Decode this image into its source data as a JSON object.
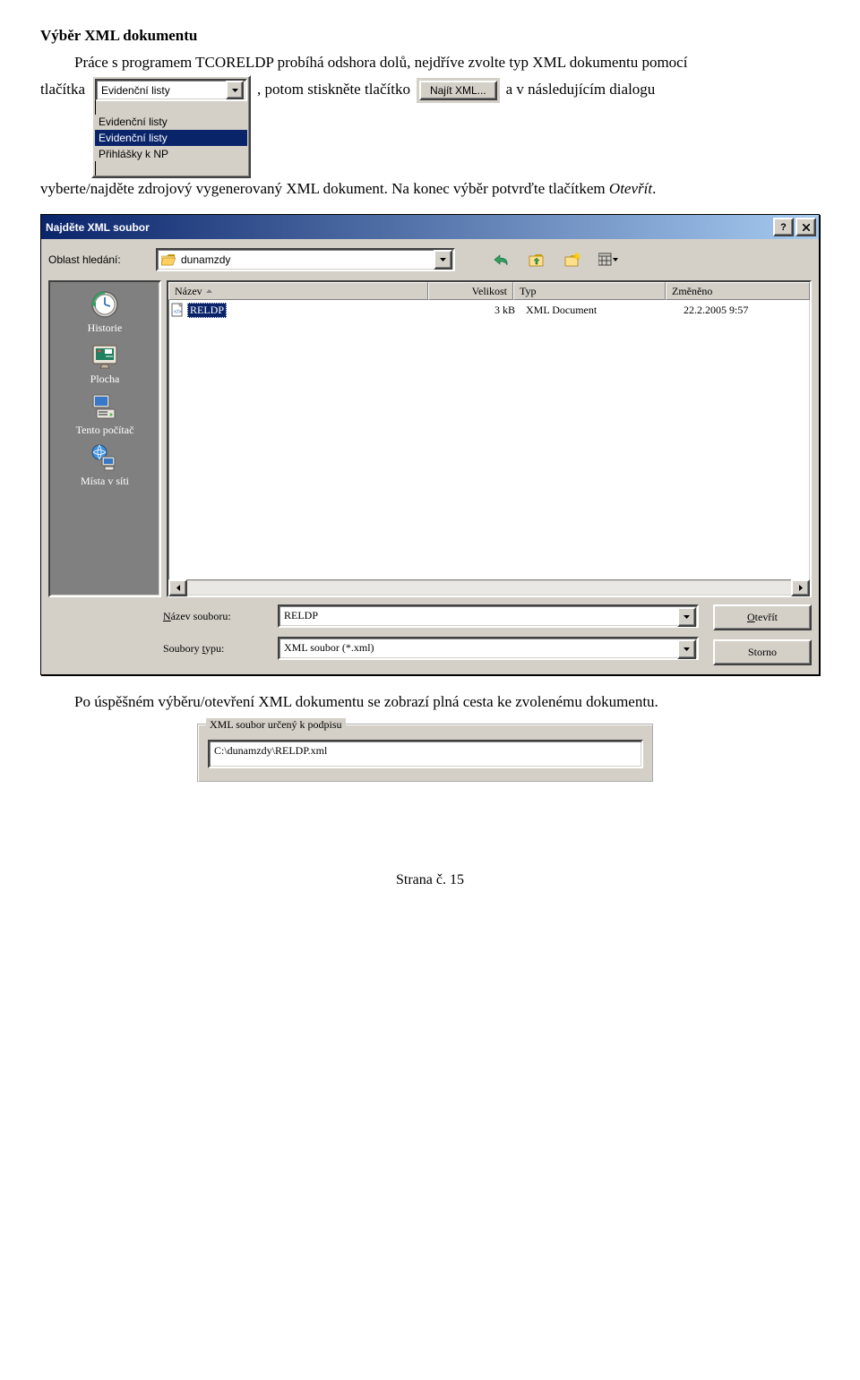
{
  "heading": "Výběr XML dokumentu",
  "intro": "Práce s programem TCORELDP probíhá odshora dolů, nejdříve zvolte typ XML dokumentu pomocí",
  "line2": {
    "t1": "tlačítka",
    "t2": ", potom stiskněte tlačítko",
    "t3": "a v následujícím dialogu"
  },
  "line3": {
    "t1": "vyberte/najděte zdrojový vygenerovaný XML dokument. Na konec výběr potvrďte tlačítkem ",
    "italic": "Otevřít",
    "t2": "."
  },
  "dropdown": {
    "selected": "Evidenční listy",
    "options": [
      "Evidenční listy",
      "Evidenční listy",
      "Přihlášky k NP"
    ]
  },
  "findButton": "Najít XML...",
  "dialog": {
    "title": "Najděte XML soubor",
    "lookInLabel": "Oblast hledání:",
    "lookInValue": "dunamzdy",
    "columns": {
      "name": "Název",
      "size": "Velikost",
      "type": "Typ",
      "modified": "Změněno"
    },
    "row": {
      "name": "RELDP",
      "size": "3 kB",
      "type": "XML Document",
      "modified": "22.2.2005 9:57"
    },
    "sidebar": [
      "Historie",
      "Plocha",
      "Tento počítač",
      "Místa v síti"
    ],
    "fileNameLabel": "Název souboru:",
    "fileNameValue": "RELDP",
    "fileTypeLabel": "Soubory typu:",
    "fileTypeValue": "XML soubor (*.xml)",
    "openBtn": "Otevřít",
    "cancelBtn": "Storno"
  },
  "afterDialog": "Po úspěšném výběru/otevření XML dokumentu se zobrazí plná cesta ke zvolenému dokumentu.",
  "group": {
    "legend": "XML soubor určený k podpisu",
    "path": "C:\\dunamzdy\\RELDP.xml"
  },
  "footer": "Strana č. 15"
}
